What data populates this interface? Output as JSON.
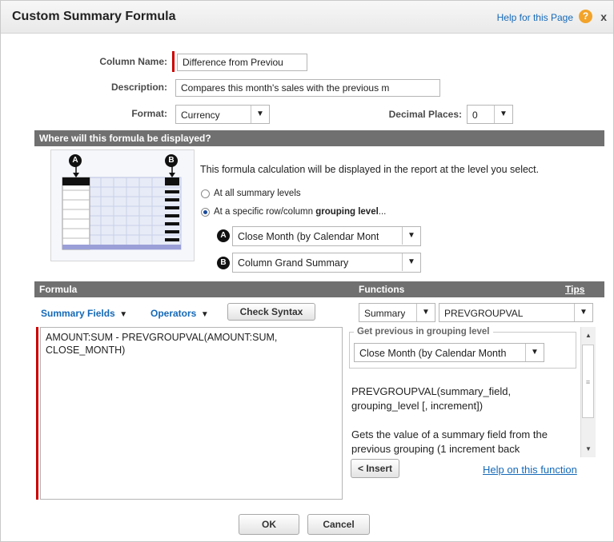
{
  "dialog": {
    "title": "Custom Summary Formula",
    "help_link": "Help for this Page",
    "help_icon": "?",
    "close_icon": "x"
  },
  "fields": {
    "column_name_label": "Column Name:",
    "column_name_value": "Difference from Previou",
    "description_label": "Description:",
    "description_value": "Compares this month's sales with the previous m",
    "format_label": "Format:",
    "format_value": "Currency",
    "decimal_places_label": "Decimal Places:",
    "decimal_places_value": "0"
  },
  "display_section": {
    "header": "Where will this formula be displayed?",
    "intro": "This formula calculation will be displayed in the report at the level you select.",
    "option_all": "At all summary levels",
    "option_specific_prefix": "At a specific row/column ",
    "option_specific_bold": "grouping level",
    "option_specific_suffix": "...",
    "badge_a": "A",
    "badge_b": "B",
    "row_grouping_value": "Close Month (by Calendar Mont",
    "column_grouping_value": "Column Grand Summary"
  },
  "formula_section": {
    "header": "Formula",
    "summary_fields": "Summary Fields",
    "operators": "Operators",
    "check_syntax": "Check Syntax",
    "formula_text": "AMOUNT:SUM - PREVGROUPVAL(AMOUNT:SUM, CLOSE_MONTH)"
  },
  "functions_section": {
    "header": "Functions",
    "tips": "Tips",
    "category_value": "Summary",
    "function_value": "PREVGROUPVAL",
    "group_legend": "Get previous in grouping level",
    "grouping_value": "Close Month (by Calendar Month",
    "signature": "PREVGROUPVAL(summary_field, grouping_level [, increment])",
    "description": "Gets the value of a summary field from the previous grouping (1 increment back",
    "insert_button": "< Insert",
    "help_function": "Help on this function"
  },
  "footer": {
    "ok": "OK",
    "cancel": "Cancel"
  },
  "colors": {
    "section_bar": "#707070",
    "link": "#1569b8",
    "required": "#cc0000"
  }
}
